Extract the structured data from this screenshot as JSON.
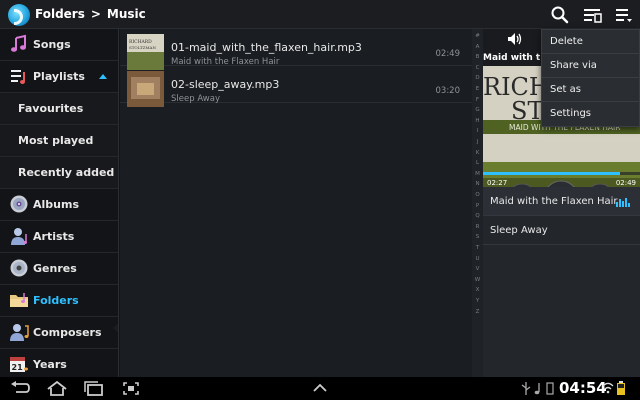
{
  "topbar": {
    "breadcrumb_root": "Folders",
    "breadcrumb_separator": ">",
    "breadcrumb_current": "Music",
    "icons": [
      "search-icon",
      "filter-icon",
      "menu-icon"
    ]
  },
  "sidebar": {
    "items": [
      {
        "label": "Songs",
        "icon": "music-note-icon"
      },
      {
        "label": "Playlists",
        "icon": "playlist-icon"
      },
      {
        "label": "Favourites"
      },
      {
        "label": "Most played"
      },
      {
        "label": "Recently added"
      },
      {
        "label": "Albums",
        "icon": "cd-icon"
      },
      {
        "label": "Artists",
        "icon": "person-icon"
      },
      {
        "label": "Genres",
        "icon": "cd-icon"
      },
      {
        "label": "Folders",
        "icon": "folder-icon"
      },
      {
        "label": "Composers",
        "icon": "composer-icon"
      },
      {
        "label": "Years",
        "icon": "calendar-icon"
      }
    ],
    "year_icon_text": "21"
  },
  "tracks": [
    {
      "title": "01-maid_with_the_flaxen_hair.mp3",
      "subtitle": "Maid with the Flaxen Hair",
      "duration": "02:49"
    },
    {
      "title": "02-sleep_away.mp3",
      "subtitle": "Sleep Away",
      "duration": "03:20"
    }
  ],
  "album_art_text": {
    "line1": "RICHARD",
    "line2": "STOLTZMAN"
  },
  "alpha_index": [
    "#",
    "A",
    "B",
    "C",
    "D",
    "E",
    "F",
    "G",
    "H",
    "I",
    "J",
    "K",
    "L",
    "M",
    "N",
    "O",
    "P",
    "Q",
    "R",
    "S",
    "T",
    "U",
    "V",
    "W",
    "X",
    "Y",
    "Z"
  ],
  "now_playing": {
    "title_truncated": "Maid with the F",
    "art_text_1": "RICH",
    "art_text_2": "STO",
    "art_banner": "MAID WITH THE FLAXEN HAIR",
    "elapsed": "02:27",
    "total": "02:49",
    "progress": 0.87,
    "queue": [
      "Maid with the Flaxen Hair",
      "Sleep Away"
    ]
  },
  "menu": {
    "items": [
      "Delete",
      "Share via",
      "Set as",
      "Settings"
    ]
  },
  "status": {
    "time": "04:54"
  },
  "colors": {
    "accent": "#2ec0ff",
    "background": "#121417",
    "list_bg": "#1a1d21"
  }
}
